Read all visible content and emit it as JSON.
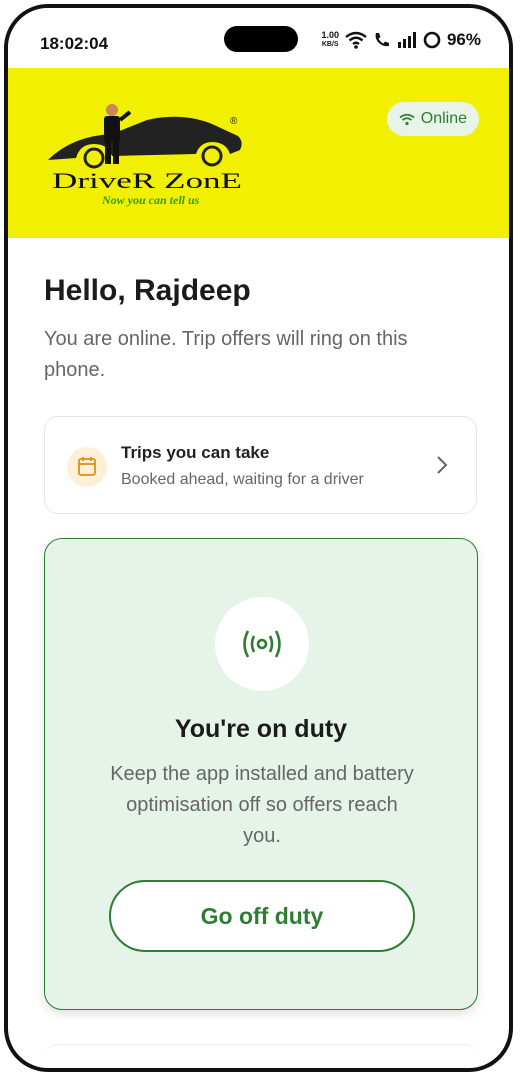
{
  "status_bar": {
    "time": "18:02:04",
    "speed_value": "1.00",
    "speed_unit": "KB/S",
    "battery": "96%"
  },
  "header": {
    "logo_brand": "DriveR ZonE",
    "logo_tagline": "Now you can tell us",
    "logo_registered": "®",
    "online_label": "Online",
    "accent_color": "#f0f000",
    "online_color": "#2e7d32"
  },
  "greeting": {
    "title": "Hello, Rajdeep",
    "subtitle": "You are online. Trip offers will ring on this phone."
  },
  "trips_card": {
    "title": "Trips you can take",
    "description": "Booked ahead, waiting for a driver",
    "icon": "calendar-icon"
  },
  "duty_card": {
    "icon": "broadcast-icon",
    "title": "You're on duty",
    "description": "Keep the app installed and battery optimisation off so offers reach you.",
    "button_label": "Go off duty",
    "accent_color": "#2e7d32",
    "background_color": "#e6f3e9"
  }
}
